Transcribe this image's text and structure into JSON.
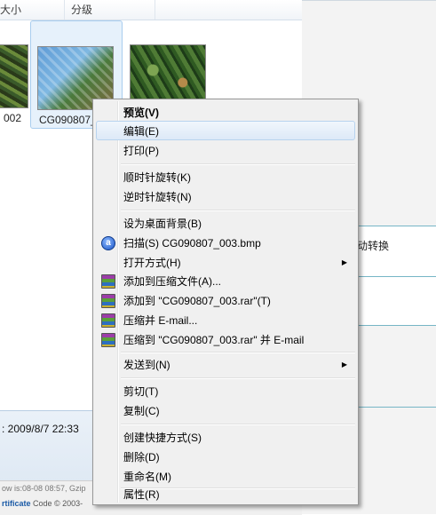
{
  "explorer": {
    "columns": [
      "大小",
      "分级"
    ],
    "items": [
      {
        "label": "002"
      },
      {
        "label": "CG090807_"
      },
      {
        "label": ""
      }
    ],
    "details_date": ": 2009/8/7 22:33",
    "status_line1": "ow is:08-08 08:57, Gzip",
    "status_line2_bold": "rtificate",
    "status_line2_rest": " Code © 2003-",
    "right_panel_text": "动转换"
  },
  "menu": {
    "items": [
      {
        "label": "预览(V)",
        "bold": true
      },
      {
        "label": "编辑(E)",
        "highlighted": true
      },
      {
        "label": "打印(P)"
      },
      {
        "label": "顺时针旋转(K)"
      },
      {
        "label": "逆时针旋转(N)"
      },
      {
        "label": "设为桌面背景(B)"
      },
      {
        "label": "扫描(S) CG090807_003.bmp",
        "icon": "scan-icon",
        "icon_glyph": "a"
      },
      {
        "label": "打开方式(H)",
        "submenu": true
      },
      {
        "label": "添加到压缩文件(A)...",
        "icon": "winrar-icon"
      },
      {
        "label": "添加到 \"CG090807_003.rar\"(T)",
        "icon": "winrar-icon"
      },
      {
        "label": "压缩并 E-mail...",
        "icon": "winrar-icon"
      },
      {
        "label": "压缩到 \"CG090807_003.rar\" 并 E-mail",
        "icon": "winrar-icon"
      },
      {
        "label": "发送到(N)",
        "submenu": true
      },
      {
        "label": "剪切(T)"
      },
      {
        "label": "复制(C)"
      },
      {
        "label": "创建快捷方式(S)"
      },
      {
        "label": "删除(D)"
      },
      {
        "label": "重命名(M)"
      },
      {
        "label": "属性(R)"
      }
    ],
    "submenu_arrow": "▶"
  }
}
